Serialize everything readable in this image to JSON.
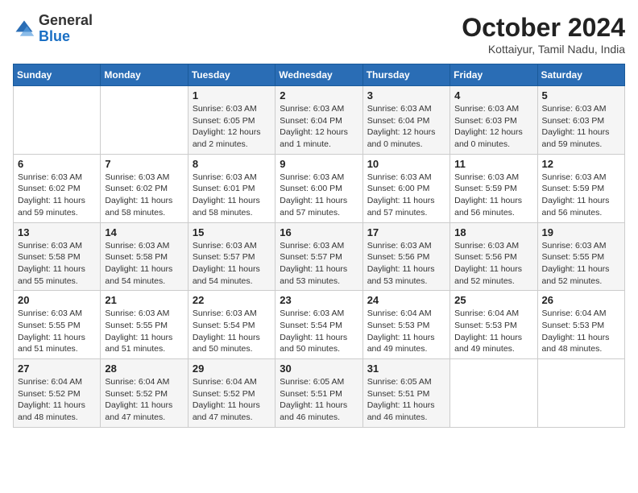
{
  "header": {
    "logo": {
      "general": "General",
      "blue": "Blue"
    },
    "title": "October 2024",
    "location": "Kottaiyur, Tamil Nadu, India"
  },
  "weekdays": [
    "Sunday",
    "Monday",
    "Tuesday",
    "Wednesday",
    "Thursday",
    "Friday",
    "Saturday"
  ],
  "weeks": [
    [
      {
        "day": "",
        "info": ""
      },
      {
        "day": "",
        "info": ""
      },
      {
        "day": "1",
        "info": "Sunrise: 6:03 AM\nSunset: 6:05 PM\nDaylight: 12 hours\nand 2 minutes."
      },
      {
        "day": "2",
        "info": "Sunrise: 6:03 AM\nSunset: 6:04 PM\nDaylight: 12 hours\nand 1 minute."
      },
      {
        "day": "3",
        "info": "Sunrise: 6:03 AM\nSunset: 6:04 PM\nDaylight: 12 hours\nand 0 minutes."
      },
      {
        "day": "4",
        "info": "Sunrise: 6:03 AM\nSunset: 6:03 PM\nDaylight: 12 hours\nand 0 minutes."
      },
      {
        "day": "5",
        "info": "Sunrise: 6:03 AM\nSunset: 6:03 PM\nDaylight: 11 hours\nand 59 minutes."
      }
    ],
    [
      {
        "day": "6",
        "info": "Sunrise: 6:03 AM\nSunset: 6:02 PM\nDaylight: 11 hours\nand 59 minutes."
      },
      {
        "day": "7",
        "info": "Sunrise: 6:03 AM\nSunset: 6:02 PM\nDaylight: 11 hours\nand 58 minutes."
      },
      {
        "day": "8",
        "info": "Sunrise: 6:03 AM\nSunset: 6:01 PM\nDaylight: 11 hours\nand 58 minutes."
      },
      {
        "day": "9",
        "info": "Sunrise: 6:03 AM\nSunset: 6:00 PM\nDaylight: 11 hours\nand 57 minutes."
      },
      {
        "day": "10",
        "info": "Sunrise: 6:03 AM\nSunset: 6:00 PM\nDaylight: 11 hours\nand 57 minutes."
      },
      {
        "day": "11",
        "info": "Sunrise: 6:03 AM\nSunset: 5:59 PM\nDaylight: 11 hours\nand 56 minutes."
      },
      {
        "day": "12",
        "info": "Sunrise: 6:03 AM\nSunset: 5:59 PM\nDaylight: 11 hours\nand 56 minutes."
      }
    ],
    [
      {
        "day": "13",
        "info": "Sunrise: 6:03 AM\nSunset: 5:58 PM\nDaylight: 11 hours\nand 55 minutes."
      },
      {
        "day": "14",
        "info": "Sunrise: 6:03 AM\nSunset: 5:58 PM\nDaylight: 11 hours\nand 54 minutes."
      },
      {
        "day": "15",
        "info": "Sunrise: 6:03 AM\nSunset: 5:57 PM\nDaylight: 11 hours\nand 54 minutes."
      },
      {
        "day": "16",
        "info": "Sunrise: 6:03 AM\nSunset: 5:57 PM\nDaylight: 11 hours\nand 53 minutes."
      },
      {
        "day": "17",
        "info": "Sunrise: 6:03 AM\nSunset: 5:56 PM\nDaylight: 11 hours\nand 53 minutes."
      },
      {
        "day": "18",
        "info": "Sunrise: 6:03 AM\nSunset: 5:56 PM\nDaylight: 11 hours\nand 52 minutes."
      },
      {
        "day": "19",
        "info": "Sunrise: 6:03 AM\nSunset: 5:55 PM\nDaylight: 11 hours\nand 52 minutes."
      }
    ],
    [
      {
        "day": "20",
        "info": "Sunrise: 6:03 AM\nSunset: 5:55 PM\nDaylight: 11 hours\nand 51 minutes."
      },
      {
        "day": "21",
        "info": "Sunrise: 6:03 AM\nSunset: 5:55 PM\nDaylight: 11 hours\nand 51 minutes."
      },
      {
        "day": "22",
        "info": "Sunrise: 6:03 AM\nSunset: 5:54 PM\nDaylight: 11 hours\nand 50 minutes."
      },
      {
        "day": "23",
        "info": "Sunrise: 6:03 AM\nSunset: 5:54 PM\nDaylight: 11 hours\nand 50 minutes."
      },
      {
        "day": "24",
        "info": "Sunrise: 6:04 AM\nSunset: 5:53 PM\nDaylight: 11 hours\nand 49 minutes."
      },
      {
        "day": "25",
        "info": "Sunrise: 6:04 AM\nSunset: 5:53 PM\nDaylight: 11 hours\nand 49 minutes."
      },
      {
        "day": "26",
        "info": "Sunrise: 6:04 AM\nSunset: 5:53 PM\nDaylight: 11 hours\nand 48 minutes."
      }
    ],
    [
      {
        "day": "27",
        "info": "Sunrise: 6:04 AM\nSunset: 5:52 PM\nDaylight: 11 hours\nand 48 minutes."
      },
      {
        "day": "28",
        "info": "Sunrise: 6:04 AM\nSunset: 5:52 PM\nDaylight: 11 hours\nand 47 minutes."
      },
      {
        "day": "29",
        "info": "Sunrise: 6:04 AM\nSunset: 5:52 PM\nDaylight: 11 hours\nand 47 minutes."
      },
      {
        "day": "30",
        "info": "Sunrise: 6:05 AM\nSunset: 5:51 PM\nDaylight: 11 hours\nand 46 minutes."
      },
      {
        "day": "31",
        "info": "Sunrise: 6:05 AM\nSunset: 5:51 PM\nDaylight: 11 hours\nand 46 minutes."
      },
      {
        "day": "",
        "info": ""
      },
      {
        "day": "",
        "info": ""
      }
    ]
  ]
}
